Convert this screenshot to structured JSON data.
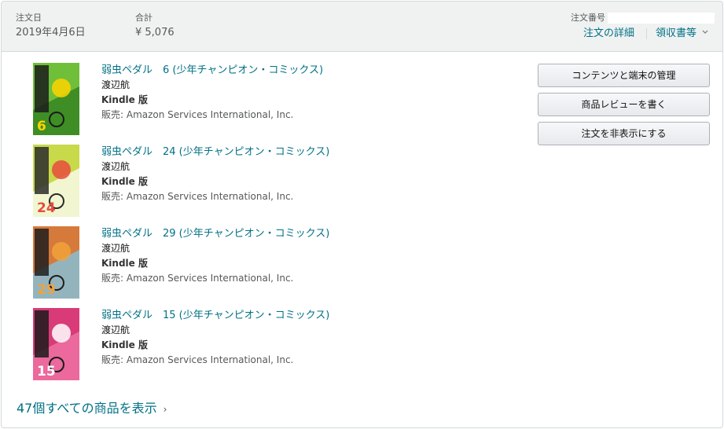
{
  "header": {
    "order_date_label": "注文日",
    "order_date": "2019年4月6日",
    "total_label": "合計",
    "total": "¥ 5,076",
    "order_number_label": "注文番号",
    "details_link": "注文の詳細",
    "receipt_link": "領収書等"
  },
  "items": [
    {
      "title": "弱虫ペダル　6 (少年チャンピオン・コミックス)",
      "author": "渡辺航",
      "format": "Kindle 版",
      "seller": "販売: Amazon Services International, Inc.",
      "volume": "6"
    },
    {
      "title": "弱虫ペダル　24 (少年チャンピオン・コミックス)",
      "author": "渡辺航",
      "format": "Kindle 版",
      "seller": "販売: Amazon Services International, Inc.",
      "volume": "24"
    },
    {
      "title": "弱虫ペダル　29 (少年チャンピオン・コミックス)",
      "author": "渡辺航",
      "format": "Kindle 版",
      "seller": "販売: Amazon Services International, Inc.",
      "volume": "29"
    },
    {
      "title": "弱虫ペダル　15 (少年チャンピオン・コミックス)",
      "author": "渡辺航",
      "format": "Kindle 版",
      "seller": "販売: Amazon Services International, Inc.",
      "volume": "15"
    }
  ],
  "actions": {
    "manage_content": "コンテンツと端末の管理",
    "write_review": "商品レビューを書く",
    "hide_order": "注文を非表示にする"
  },
  "show_all": "47個すべての商品を表示",
  "colors": {
    "link": "#007185",
    "header_bg": "#f0f2f2",
    "border": "#d5d9d9"
  }
}
